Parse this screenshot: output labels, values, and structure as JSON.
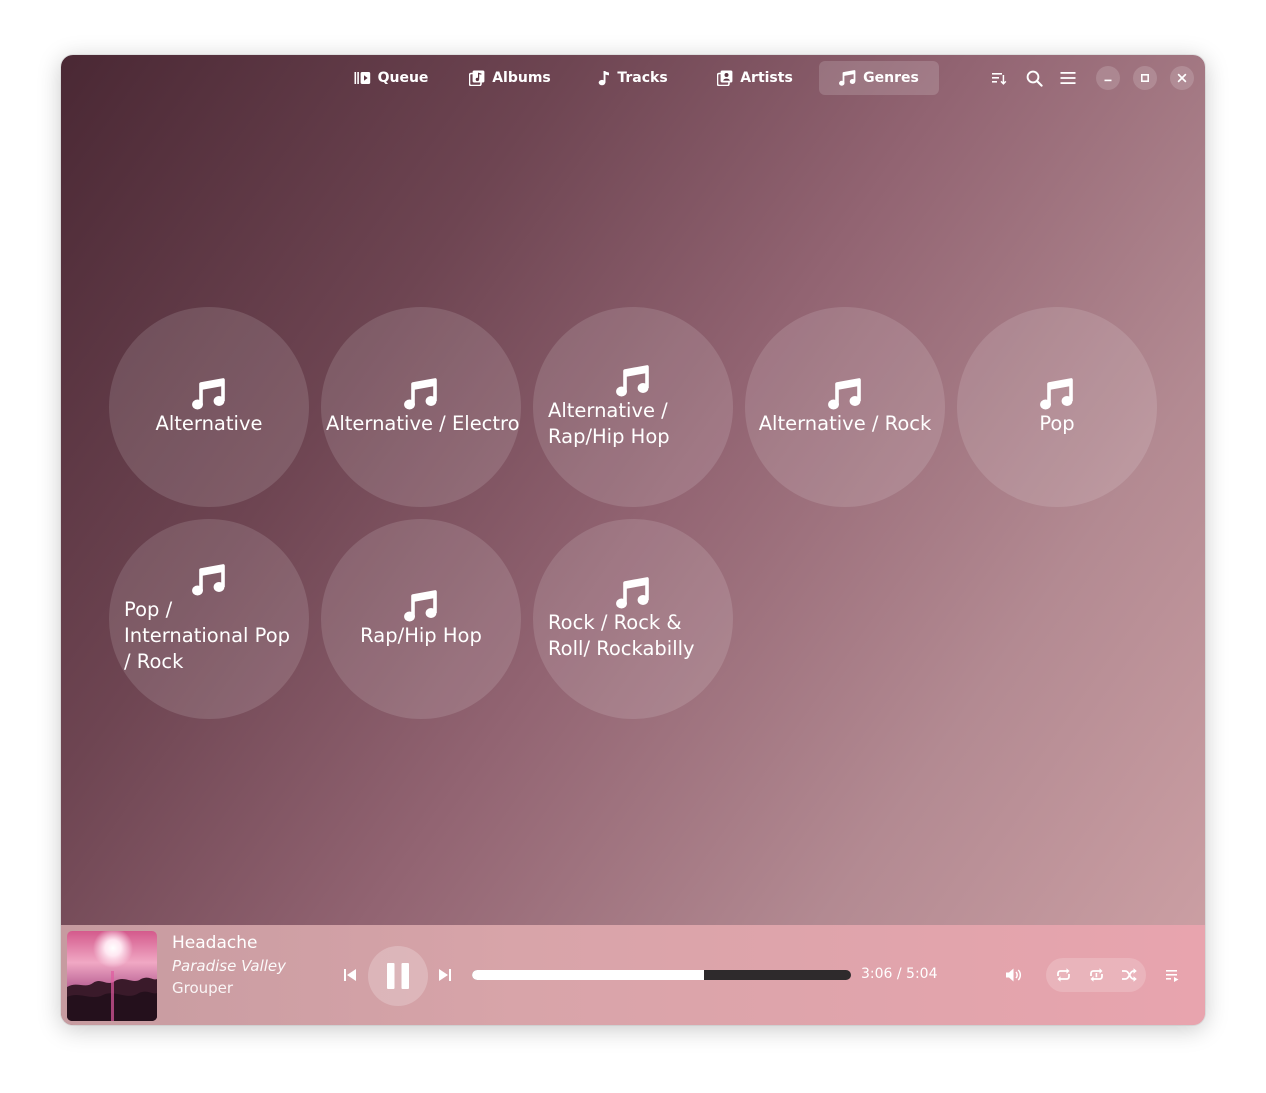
{
  "tabs": [
    {
      "label": "Queue",
      "icon": "queue-icon"
    },
    {
      "label": "Albums",
      "icon": "albums-icon"
    },
    {
      "label": "Tracks",
      "icon": "music-note-icon"
    },
    {
      "label": "Artists",
      "icon": "artists-icon"
    },
    {
      "label": "Genres",
      "icon": "music-notes-icon",
      "active": true
    }
  ],
  "header_icons": [
    "sort-icon",
    "search-icon",
    "hamburger-menu-icon"
  ],
  "window_controls": [
    "minimize-icon",
    "maximize-icon",
    "close-icon"
  ],
  "genres": [
    {
      "label": "Alternative"
    },
    {
      "label": "Alternative / Electro"
    },
    {
      "label": "Alternative / Rap/Hip Hop"
    },
    {
      "label": "Alternative / Rock"
    },
    {
      "label": "Pop"
    },
    {
      "label": "Pop / International Pop / Rock"
    },
    {
      "label": "Rap/Hip Hop"
    },
    {
      "label": "Rock / Rock & Roll/ Rockabilly"
    }
  ],
  "player": {
    "title": "Headache",
    "album": "Paradise Valley",
    "artist": "Grouper",
    "time": "3:06 / 5:04",
    "progress": 0.612,
    "controls": [
      "previous-icon",
      "pause-icon",
      "next-icon",
      "volume-icon",
      "repeat-icon",
      "repeat-one-icon",
      "shuffle-icon",
      "playlist-icon"
    ]
  },
  "colors": {
    "background_dark": "#4a2834",
    "background_light": "#cfa2a6",
    "player_bar": "#e8a4ae",
    "progress_track": "#2e2a2c",
    "foreground": "#ffffff"
  }
}
